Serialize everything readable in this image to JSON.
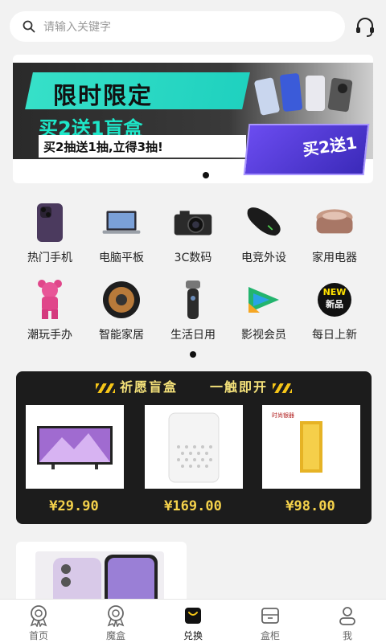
{
  "search": {
    "placeholder": "请输入关键字"
  },
  "banner": {
    "title": "限时限定",
    "promo": "买2送1盲盒",
    "subtitle": "买2抽送1抽,立得3抽!",
    "box_label": "买2送1"
  },
  "categories": [
    {
      "label": "热门手机",
      "icon": "smartphone-icon"
    },
    {
      "label": "电脑平板",
      "icon": "laptop-icon"
    },
    {
      "label": "3C数码",
      "icon": "camera-icon"
    },
    {
      "label": "电竞外设",
      "icon": "gaming-mouse-icon"
    },
    {
      "label": "家用电器",
      "icon": "rice-cooker-icon"
    },
    {
      "label": "潮玩手办",
      "icon": "bear-figure-icon"
    },
    {
      "label": "智能家居",
      "icon": "robot-vacuum-icon"
    },
    {
      "label": "生活日用",
      "icon": "shaver-icon"
    },
    {
      "label": "影视会员",
      "icon": "video-play-icon"
    },
    {
      "label": "每日上新",
      "icon": "new-badge-icon",
      "badge_top": "NEW",
      "badge_bottom": "新品"
    }
  ],
  "wish": {
    "title": "祈愿盲盒",
    "subtitle": "一触即开",
    "items": [
      {
        "price": "¥29.90",
        "image": "tv-icon"
      },
      {
        "price": "¥169.00",
        "image": "air-purifier-icon"
      },
      {
        "price": "¥98.00",
        "image": "gold-bar-icon",
        "brand": "时尚银器"
      }
    ]
  },
  "nav": [
    {
      "label": "首页",
      "icon": "medal-icon"
    },
    {
      "label": "魔盒",
      "icon": "medal-icon"
    },
    {
      "label": "兑换",
      "icon": "shopping-bag-icon",
      "active": true
    },
    {
      "label": "盒柜",
      "icon": "cabinet-icon"
    },
    {
      "label": "我",
      "icon": "user-icon"
    }
  ],
  "colors": {
    "accent": "#f5d24b",
    "teal": "#1ee6c8",
    "dark": "#1c1c1c"
  }
}
